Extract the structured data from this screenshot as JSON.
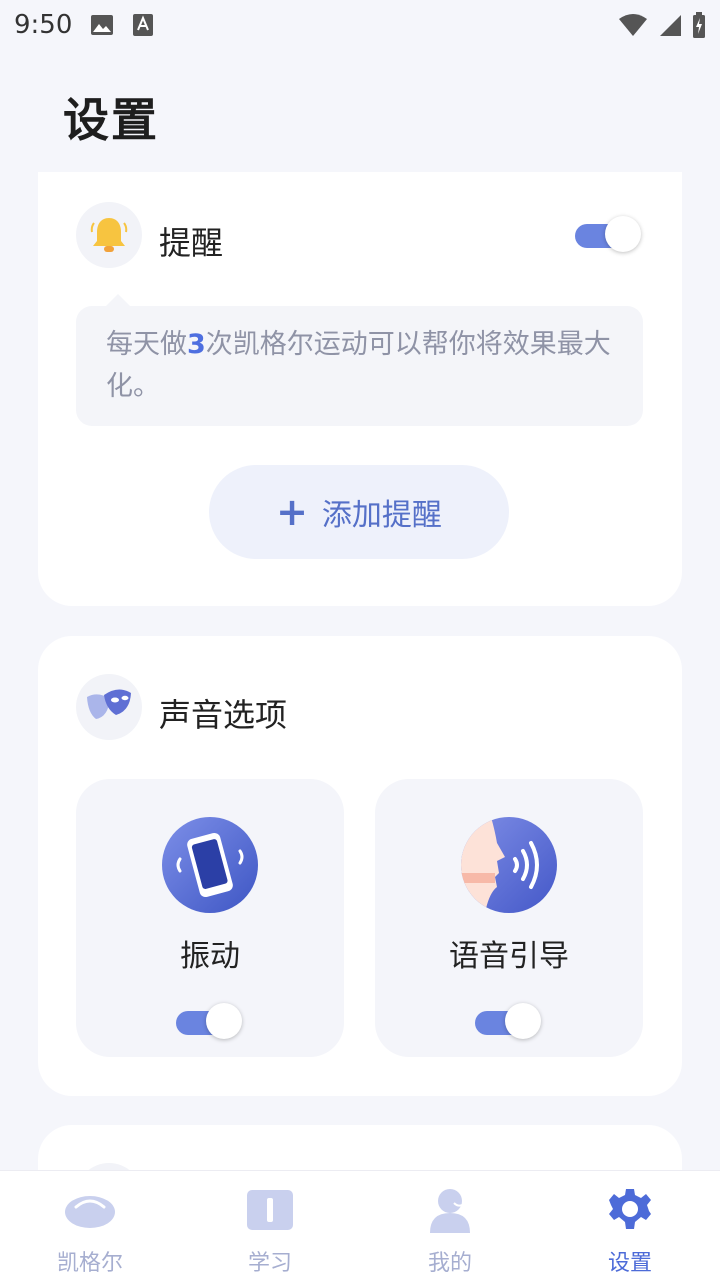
{
  "status_bar": {
    "time": "9:50",
    "icons": [
      "image-icon",
      "accessibility-a-icon",
      "wifi-icon",
      "cell-signal-icon",
      "battery-charging-icon"
    ]
  },
  "page": {
    "title": "设置"
  },
  "reminder": {
    "title": "提醒",
    "enabled": true,
    "tip_prefix": "每天做",
    "tip_count": "3",
    "tip_suffix": "次凯格尔运动可以帮你将效果最大化。",
    "add_label": "添加提醒",
    "icon": "bell-icon"
  },
  "sound": {
    "title": "声音选项",
    "icon": "mask-icon",
    "options": [
      {
        "label": "振动",
        "enabled": true,
        "icon": "vibrating-phone-icon"
      },
      {
        "label": "语音引导",
        "enabled": true,
        "icon": "voice-guide-icon"
      }
    ]
  },
  "nav": {
    "items": [
      {
        "label": "凯格尔",
        "icon": "kegel-icon",
        "active": false
      },
      {
        "label": "学习",
        "icon": "book-icon",
        "active": false
      },
      {
        "label": "我的",
        "icon": "user-icon",
        "active": false
      },
      {
        "label": "设置",
        "icon": "gear-icon",
        "active": true
      }
    ]
  },
  "colors": {
    "accent": "#4d6bd8",
    "toggle_on": "#6a84e0",
    "nav_inactive": "#a6aed0",
    "background": "#f5f6fb"
  }
}
